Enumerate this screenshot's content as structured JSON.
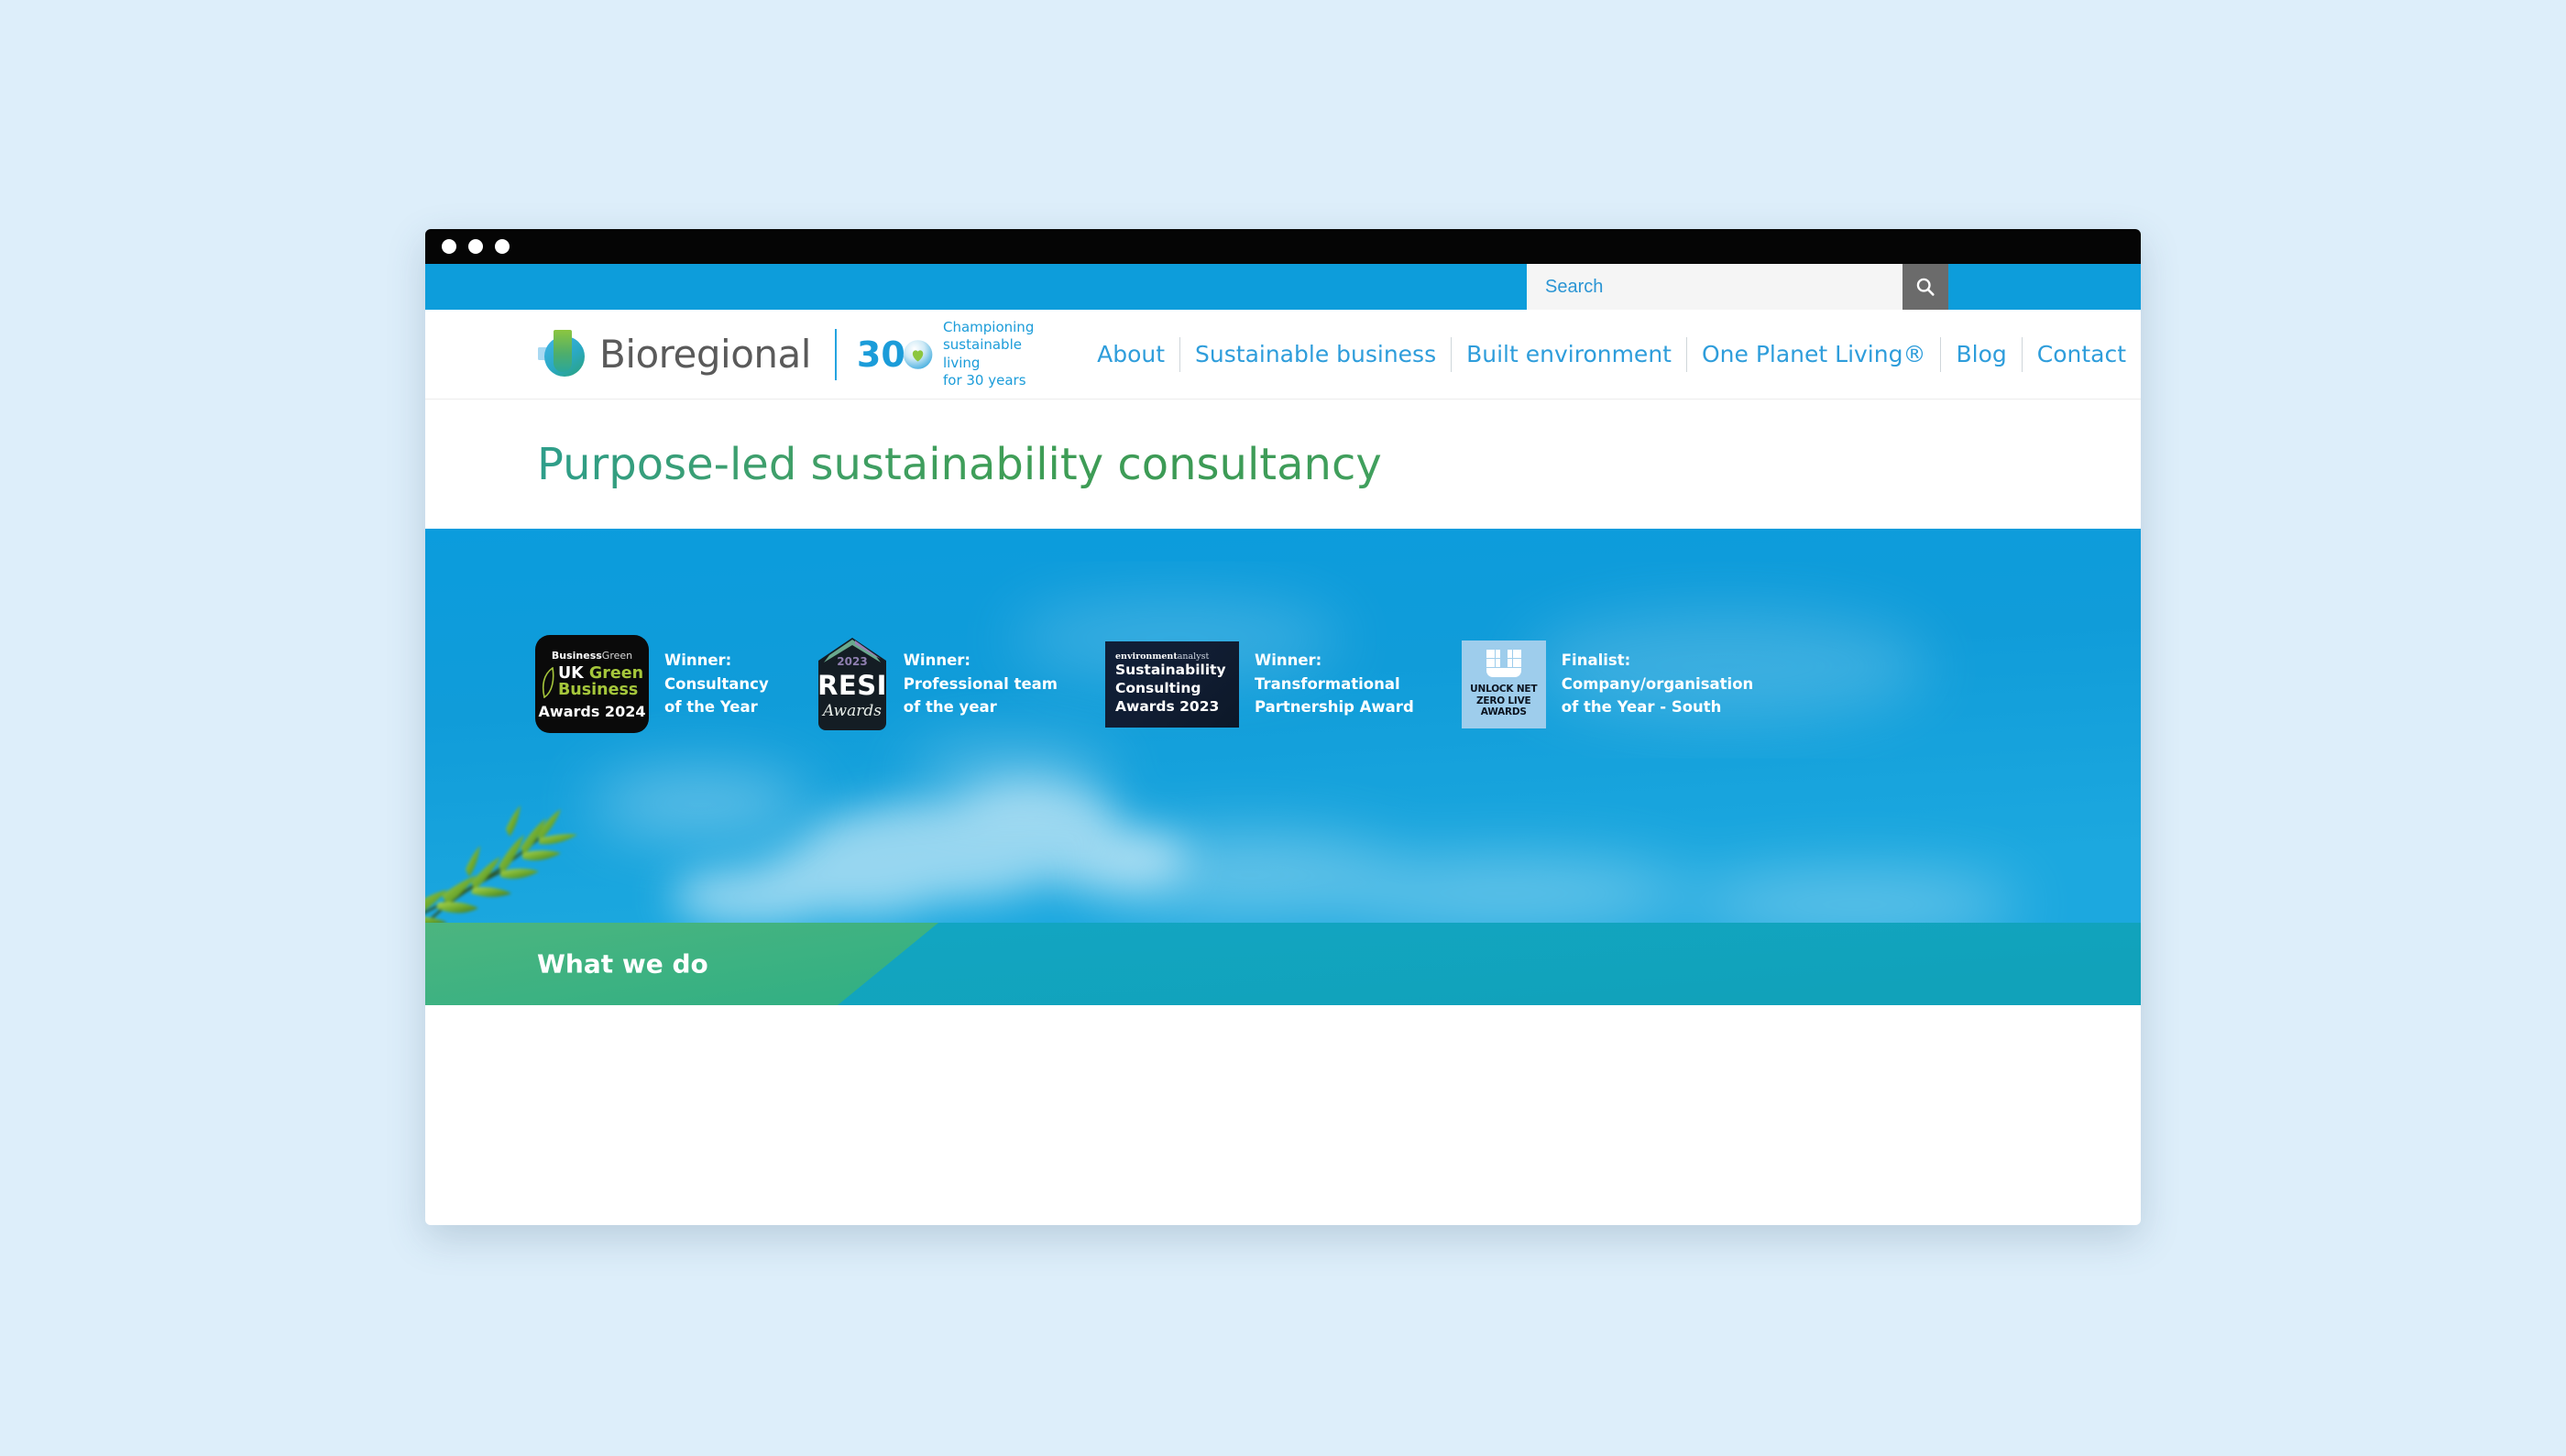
{
  "window": {
    "dots": [
      "dot-1",
      "dot-2",
      "dot-3"
    ]
  },
  "search": {
    "placeholder": "Search",
    "value": "",
    "button_icon": "search-icon"
  },
  "brand": {
    "name": "Bioregional",
    "anniversary_number": "30",
    "anniversary_badge_icon": "heart-icon",
    "tagline_line1": "Championing",
    "tagline_line2": "sustainable living",
    "tagline_line3": "for 30 years"
  },
  "nav": {
    "items": [
      {
        "label": "About"
      },
      {
        "label": "Sustainable business"
      },
      {
        "label": "Built environment"
      },
      {
        "label": "One Planet Living®"
      },
      {
        "label": "Blog"
      },
      {
        "label": "Contact"
      }
    ]
  },
  "page": {
    "title": "Purpose-led sustainability consultancy"
  },
  "awards": [
    {
      "badge_type": "business-green",
      "logo_top_bold": "Business",
      "logo_top_light": "Green",
      "logo_line1_white": "UK ",
      "logo_line1_green": "Green",
      "logo_line2": "Business",
      "logo_line3": "Awards 2024",
      "caption_line1": "Winner:",
      "caption_line2": "Consultancy",
      "caption_line3": "of the Year"
    },
    {
      "badge_type": "resi",
      "logo_year": "2023",
      "logo_main": "RESI",
      "logo_sub": "Awards",
      "caption_line1": "Winner:",
      "caption_line2": "Professional team",
      "caption_line3": "of the year"
    },
    {
      "badge_type": "sustainability-consulting",
      "logo_top_bold": "environment",
      "logo_top_light": "analyst",
      "logo_line1": "Sustainability",
      "logo_line2": "Consulting",
      "logo_line3": "Awards 2023",
      "caption_line1": "Winner:",
      "caption_line2": "Transformational",
      "caption_line3": "Partnership Award"
    },
    {
      "badge_type": "unlock-net-zero",
      "logo_line1": "UNLOCK NET",
      "logo_line2": "ZERO LIVE AWARDS",
      "caption_line1": "Finalist:",
      "caption_line2": "Company/organisation",
      "caption_line3": "of the Year - South"
    }
  ],
  "what_we_do": {
    "label": "What we do"
  },
  "colors": {
    "page_background": "#ddeefa",
    "brand_blue": "#0d9ddb",
    "nav_link": "#2e9ddb",
    "hero_sky": "#0f9ad9",
    "band_teal": "#11a5bf",
    "band_green": "#3fae7e",
    "title_gradient_start": "#2e9e8b",
    "title_gradient_end": "#41a05e",
    "search_button": "#6b6b6b"
  }
}
